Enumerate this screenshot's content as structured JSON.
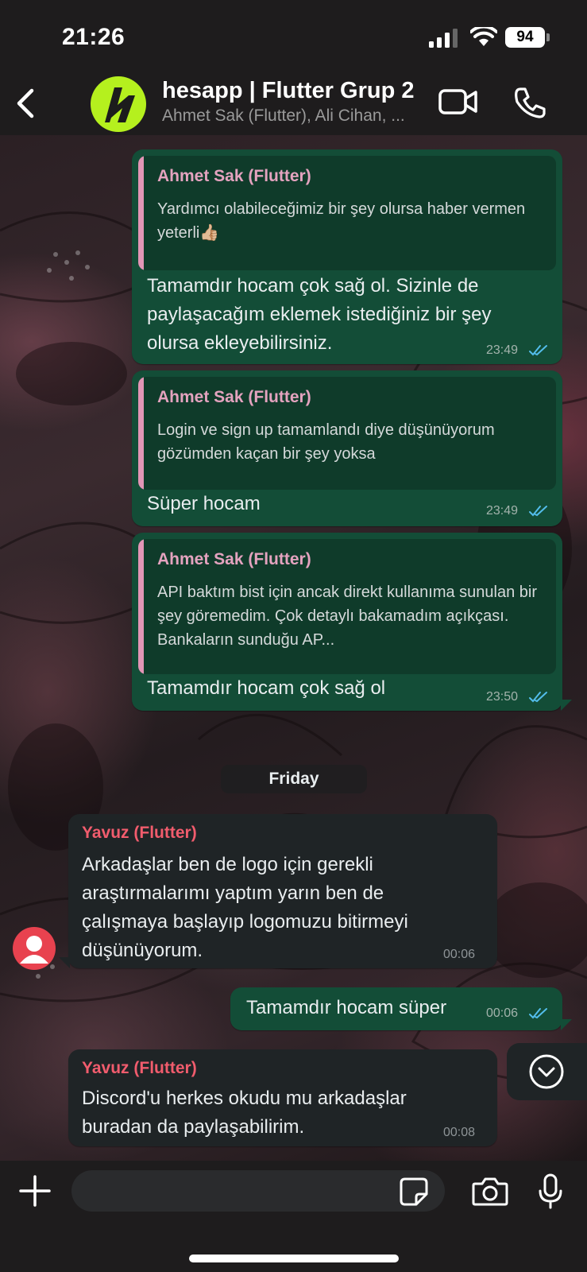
{
  "status_bar": {
    "time": "21:26",
    "battery": "94"
  },
  "header": {
    "title": "hesapp | Flutter Grup 2",
    "members": "Ahmet Sak (Flutter), Ali Cihan, ..."
  },
  "messages": [
    {
      "direction": "out",
      "quote_author": "Ahmet Sak (Flutter)",
      "quote_text": "Yardımcı olabileceğimiz bir şey olursa haber vermen yeterli👍🏼",
      "text": "Tamamdır hocam çok sağ ol. Sizinle de paylaşacağım eklemek istediğiniz bir şey olursa ekleyebilirsiniz.",
      "time": "23:49",
      "status": "read"
    },
    {
      "direction": "out",
      "quote_author": "Ahmet Sak (Flutter)",
      "quote_text": "Login ve sign up tamamlandı diye düşünüyorum gözümden kaçan bir şey yoksa",
      "text": "Süper hocam",
      "time": "23:49",
      "status": "read"
    },
    {
      "direction": "out",
      "quote_author": "Ahmet Sak (Flutter)",
      "quote_text": "API baktım bist için ancak direkt kullanıma sunulan bir şey göremedim. Çok detaylı bakamadım açıkçası. Bankaların sunduğu AP...",
      "text": "Tamamdır hocam çok sağ ol",
      "time": "23:50",
      "status": "read"
    },
    {
      "direction": "in",
      "sender": "Yavuz (Flutter)",
      "text": "Arkadaşlar ben de logo için gerekli araştırmalarımı yaptım yarın ben de çalışmaya başlayıp logomuzu bitirmeyi düşünüyorum.",
      "time": "00:06"
    },
    {
      "direction": "out",
      "text": "Tamamdır hocam süper",
      "time": "00:06",
      "status": "read"
    },
    {
      "direction": "in",
      "sender": "Yavuz (Flutter)",
      "text": "Discord'u herkes okudu mu arkadaşlar buradan da paylaşabilirim.",
      "time": "00:08"
    }
  ],
  "date_separator": "Friday",
  "composer": {
    "value": "",
    "placeholder": ""
  },
  "colors": {
    "outgoing_bubble": "#134d37",
    "incoming_bubble": "#1f2426",
    "quote_bar": "#e295b6",
    "sender_name": "#f15c6d",
    "read_tick": "#53bdeb",
    "group_avatar": "#b5f01e"
  },
  "icons": [
    "back-icon",
    "video-call-icon",
    "phone-icon",
    "plus-icon",
    "sticker-icon",
    "camera-icon",
    "mic-icon",
    "chevron-down-icon",
    "double-check-icon",
    "user-avatar-icon"
  ]
}
